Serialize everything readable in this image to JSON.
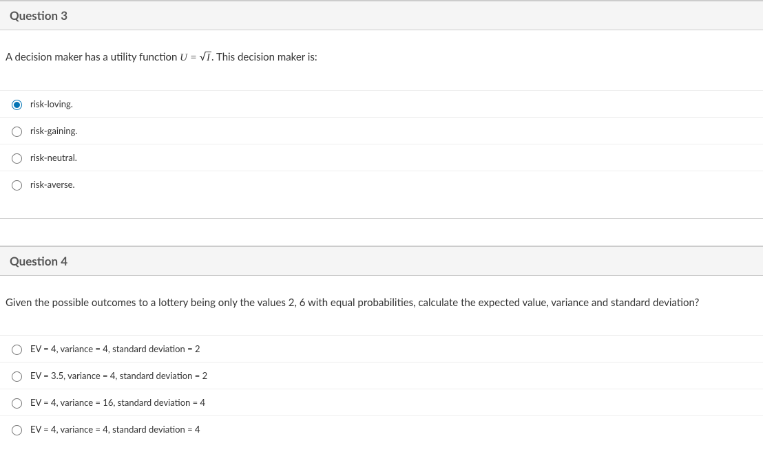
{
  "questions": [
    {
      "header": "Question 3",
      "body_prefix": "A decision maker has a utility function ",
      "formula_lhs": "U",
      "formula_eq": " = ",
      "formula_sqrt_arg": "I",
      "body_suffix": ". This decision maker is:",
      "selected_index": 0,
      "options": [
        {
          "label": "risk-loving."
        },
        {
          "label": "risk-gaining."
        },
        {
          "label": "risk-neutral."
        },
        {
          "label": "risk-averse."
        }
      ]
    },
    {
      "header": "Question 4",
      "body_full": "Given the possible outcomes to a lottery being only the values 2, 6 with equal probabilities, calculate the expected value, variance and standard deviation?",
      "selected_index": -1,
      "options": [
        {
          "label": "EV = 4, variance = 4, standard deviation = 2"
        },
        {
          "label": "EV = 3.5, variance = 4, standard deviation = 2"
        },
        {
          "label": "EV = 4, variance = 16, standard deviation = 4"
        },
        {
          "label": "EV = 4, variance = 4, standard deviation = 4"
        }
      ]
    }
  ]
}
